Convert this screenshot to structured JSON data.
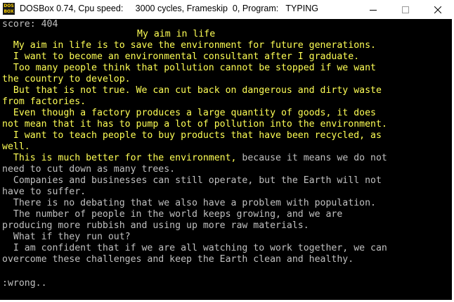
{
  "window": {
    "title": "DOSBox 0.74, Cpu speed:     3000 cycles, Frameskip  0, Program:   TYPING",
    "icon_label_top": "DOS",
    "icon_label_bottom": "BOX",
    "icon": "dosbox-icon",
    "controls": [
      "minimize-icon",
      "maximize-icon",
      "close-icon"
    ]
  },
  "colors": {
    "typed": "#ffff55",
    "untyped": "#c0c0c0",
    "background": "#000000"
  },
  "score_text": "score: 404",
  "title_line": "My aim in life",
  "lines": [
    {
      "typed": "  My aim in life is to save the environment for future generations.",
      "rest": ""
    },
    {
      "typed": "  I want to become an environmental consultant after I graduate.",
      "rest": ""
    },
    {
      "typed": "  Too many people think that pollution cannot be stopped if we want",
      "rest": ""
    },
    {
      "typed": "the country to develop.",
      "rest": ""
    },
    {
      "typed": "  But that is not true. We can cut back on dangerous and dirty waste",
      "rest": ""
    },
    {
      "typed": "from factories.",
      "rest": ""
    },
    {
      "typed": "  Even though a factory produces a large quantity of goods, it does",
      "rest": ""
    },
    {
      "typed": "not mean that it has to pump a lot of pollution into the environment.",
      "rest": ""
    },
    {
      "typed": "  I want to teach people to buy products that have been recycled, as",
      "rest": ""
    },
    {
      "typed": "well.",
      "rest": ""
    },
    {
      "typed": "  This is much better for the environment,",
      "rest": " because it means we do not"
    },
    {
      "typed": "",
      "rest": "need to cut down as many trees."
    },
    {
      "typed": "",
      "rest": "  Companies and businesses can still operate, but the Earth will not"
    },
    {
      "typed": "",
      "rest": "have to suffer."
    },
    {
      "typed": "",
      "rest": "  There is no debating that we also have a problem with population."
    },
    {
      "typed": "",
      "rest": "  The number of people in the world keeps growing, and we are"
    },
    {
      "typed": "",
      "rest": "producing more rubbish and using up more raw materials."
    },
    {
      "typed": "",
      "rest": "  What if they run out?"
    },
    {
      "typed": "",
      "rest": "  I am confident that if we are all watching to work together, we can"
    },
    {
      "typed": "",
      "rest": "overcome these challenges and keep the Earth clean and healthy."
    }
  ],
  "status_text": ":wrong.."
}
